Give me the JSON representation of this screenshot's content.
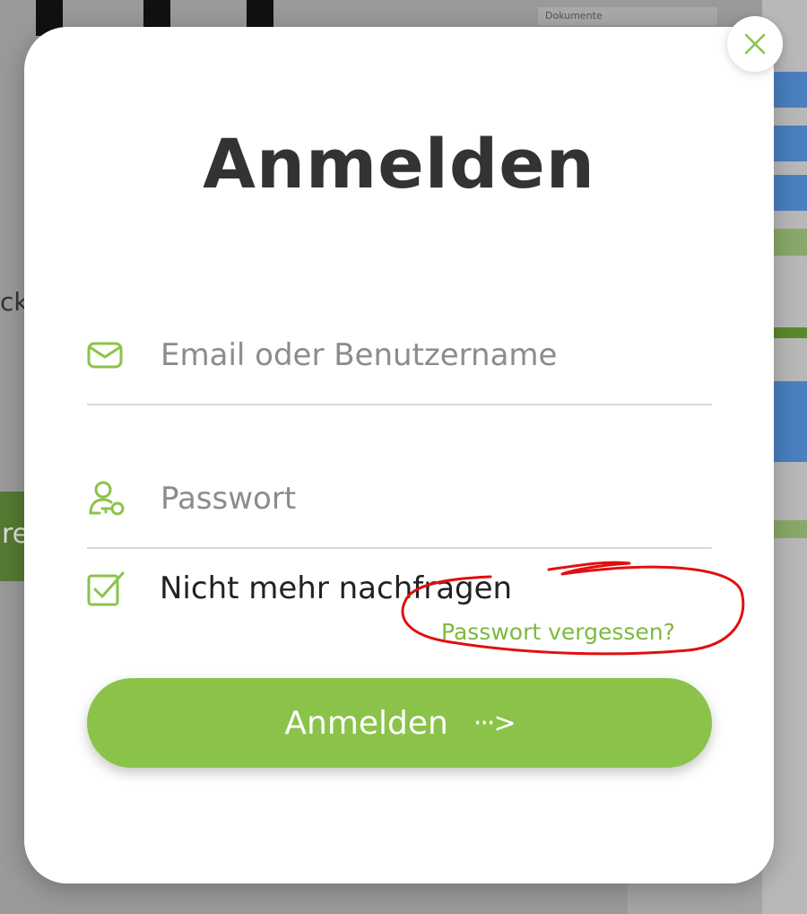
{
  "background": {
    "doc_tab": "Dokumente",
    "left_text": "ck",
    "left_green_text": "re"
  },
  "modal": {
    "title": "Anmelden",
    "email": {
      "placeholder": "Email oder Benutzername",
      "icon": "mail-icon"
    },
    "password": {
      "placeholder": "Passwort",
      "icon": "user-key-icon"
    },
    "remember": {
      "label": "Nicht mehr nachfragen",
      "checked": true,
      "icon": "checkbox-checked-icon"
    },
    "forgot_link": "Passwort vergessen?",
    "submit": {
      "label": "Anmelden",
      "arrow": "···>"
    },
    "close_icon": "close-icon"
  },
  "colors": {
    "accent": "#8bc34a",
    "link": "#7dba3d",
    "title": "#333333",
    "annotation": "#e01010"
  }
}
